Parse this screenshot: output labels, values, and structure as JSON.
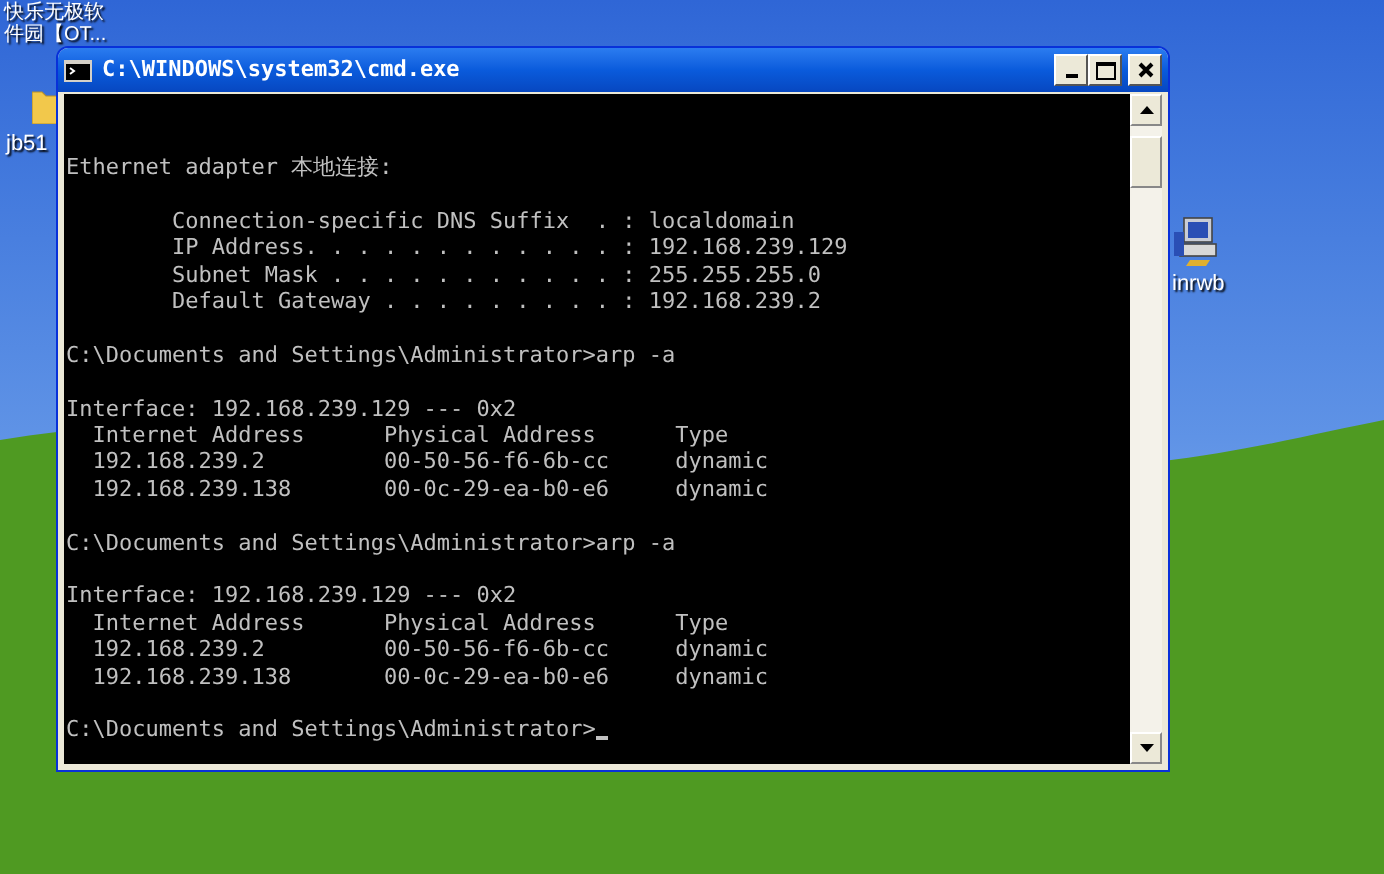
{
  "desktop": {
    "icons": [
      {
        "kind": "top",
        "label": "快乐无极软件园【OT..."
      },
      {
        "kind": "folder",
        "label": "jb51"
      },
      {
        "kind": "computer",
        "label": "inrwb"
      }
    ]
  },
  "window": {
    "title": "C:\\WINDOWS\\system32\\cmd.exe",
    "console": {
      "blocks": [
        [
          "Ethernet adapter 本地连接:"
        ],
        [
          "        Connection-specific DNS Suffix  . : localdomain",
          "        IP Address. . . . . . . . . . . . : 192.168.239.129",
          "        Subnet Mask . . . . . . . . . . . : 255.255.255.0",
          "        Default Gateway . . . . . . . . . : 192.168.239.2"
        ],
        [
          "C:\\Documents and Settings\\Administrator>arp -a"
        ],
        [
          "Interface: 192.168.239.129 --- 0x2",
          "  Internet Address      Physical Address      Type",
          "  192.168.239.2         00-50-56-f6-6b-cc     dynamic",
          "  192.168.239.138       00-0c-29-ea-b0-e6     dynamic"
        ],
        [
          "C:\\Documents and Settings\\Administrator>arp -a"
        ],
        [
          "Interface: 192.168.239.129 --- 0x2",
          "  Internet Address      Physical Address      Type",
          "  192.168.239.2         00-50-56-f6-6b-cc     dynamic",
          "  192.168.239.138       00-0c-29-ea-b0-e6     dynamic"
        ],
        [
          "C:\\Documents and Settings\\Administrator>"
        ]
      ]
    }
  }
}
